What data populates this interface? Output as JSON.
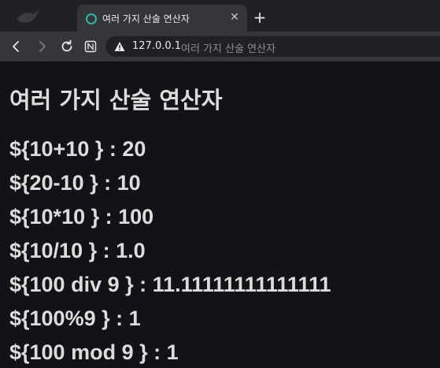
{
  "browser": {
    "tab": {
      "title": "여러 가지 산술 연산자",
      "close_glyph": "✕"
    },
    "new_tab_glyph": "+",
    "address_bar": {
      "host": "127.0.0.1",
      "page_title": "여러 가지 산술 연산자"
    }
  },
  "page": {
    "heading": "여러 가지 산술 연산자",
    "results": [
      "${10+10 } : 20",
      "${20-10 } : 10",
      "${10*10 } : 100",
      "${10/10 } : 1.0",
      "${100 div 9 } : 11.11111111111111",
      "${100%9 } : 1",
      "${100 mod 9 } : 1"
    ]
  },
  "icons": {
    "favicon": "circle-outline-icon",
    "back": "back-arrow-icon",
    "forward": "forward-arrow-icon",
    "reload": "reload-icon",
    "reader": "reader-mode-icon",
    "security": "not-secure-warning-icon"
  },
  "colors": {
    "page_background": "#121316",
    "text": "#dcdcdc",
    "toolbar": "#35363a",
    "favicon_accent": "#2bb7a0"
  }
}
